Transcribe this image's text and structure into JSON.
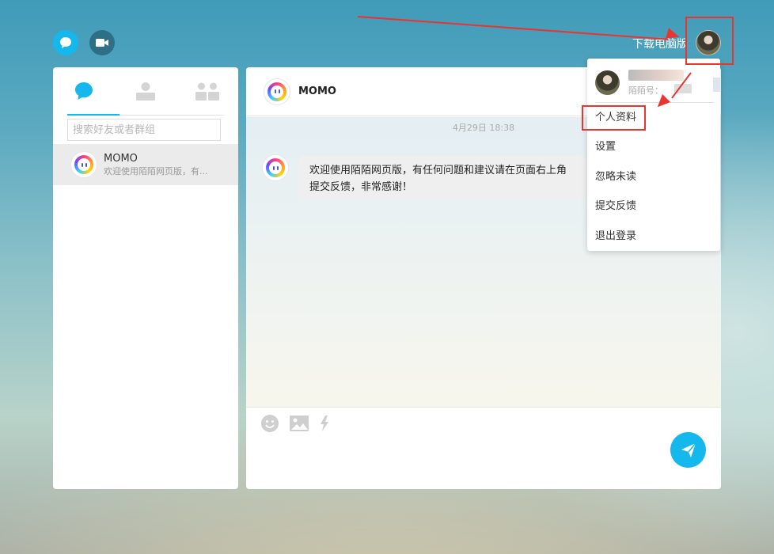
{
  "topbar": {
    "download_label": "下载电脑版",
    "icons": {
      "chat": "chat-bubble-icon",
      "video": "video-camera-icon"
    }
  },
  "sidebar": {
    "tabs": [
      {
        "icon": "chat-bubble-icon",
        "active": true
      },
      {
        "icon": "contact-person-icon",
        "active": false
      },
      {
        "icon": "group-people-icon",
        "active": false
      }
    ],
    "search_placeholder": "搜索好友或者群组",
    "conversations": [
      {
        "name": "MOMO",
        "preview": "欢迎使用陌陌网页版，有..."
      }
    ]
  },
  "chat": {
    "title": "MOMO",
    "timestamp": "4月29日 18:38",
    "messages": [
      {
        "text": "欢迎使用陌陌网页版，有任何问题和建议请在页面右上角提交反馈，非常感谢！"
      }
    ],
    "tools": [
      "emoji-icon",
      "image-icon",
      "lightning-icon"
    ],
    "send_icon": "paper-plane-icon"
  },
  "dropdown": {
    "id_label": "陌陌号：",
    "items": [
      "个人资料",
      "设置",
      "忽略未读",
      "提交反馈",
      "退出登录"
    ]
  },
  "colors": {
    "accent": "#14b8ed",
    "annotation_red": "#e8352f"
  }
}
